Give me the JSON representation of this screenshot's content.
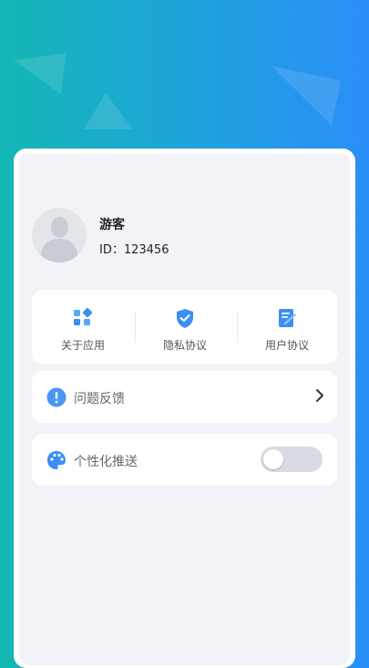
{
  "profile": {
    "username": "游客",
    "user_id": "ID：123456"
  },
  "quick_actions": [
    {
      "label": "关于应用",
      "icon": "apps-icon"
    },
    {
      "label": "隐私协议",
      "icon": "shield-check-icon"
    },
    {
      "label": "用户协议",
      "icon": "document-edit-icon"
    }
  ],
  "feedback": {
    "label": "问题反馈",
    "icon": "exclamation-circle-icon"
  },
  "personalized_push": {
    "label": "个性化推送",
    "icon": "palette-icon",
    "enabled": false
  },
  "colors": {
    "accent": "#3a8ff3",
    "background_gradient_start": "#13b7b3",
    "background_gradient_end": "#2a8ef8"
  }
}
